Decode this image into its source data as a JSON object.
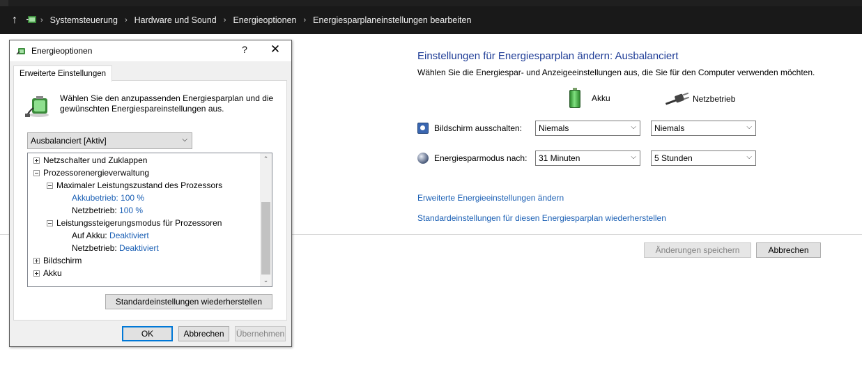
{
  "breadcrumb": [
    "Systemsteuerung",
    "Hardware und Sound",
    "Energieoptionen",
    "Energiesparplaneinstellungen bearbeiten"
  ],
  "panel": {
    "title": "Einstellungen für Energiesparplan ändern: Ausbalanciert",
    "subtitle": "Wählen Sie die Energiespar- und Anzeigeeinstellungen aus, die Sie für den Computer verwenden möchten.",
    "col_battery": "Akku",
    "col_power": "Netzbetrieb",
    "rows": [
      {
        "label": "Bildschirm ausschalten:",
        "battery": "Niemals",
        "power": "Niemals"
      },
      {
        "label": "Energiesparmodus nach:",
        "battery": "31 Minuten",
        "power": "5 Stunden"
      }
    ],
    "link_advanced": "Erweiterte Energieeinstellungen ändern",
    "link_restore": "Standardeinstellungen für diesen Energiesparplan wiederherstellen",
    "save_button": "Änderungen speichern",
    "cancel_button": "Abbrechen"
  },
  "dialog": {
    "title": "Energieoptionen",
    "help": "?",
    "close": "✕",
    "tab": "Erweiterte Einstellungen",
    "intro": "Wählen Sie den anzupassenden Energiesparplan und die gewünschten Energiespareinstellungen aus.",
    "plan": "Ausbalanciert [Aktiv]",
    "tree": {
      "netzschalter": "Netzschalter und Zuklappen",
      "prozessor": "Prozessorenergieverwaltung",
      "max_state": "Maximaler Leistungszustand des Prozessors",
      "max_battery_label": "Akkubetrieb:",
      "max_battery_value": "100 %",
      "max_power_label": "Netzbetrieb:",
      "max_power_value": "100 %",
      "boost": "Leistungssteigerungsmodus für Prozessoren",
      "boost_battery_label": "Auf Akku:",
      "boost_battery_value": "Deaktiviert",
      "boost_power_label": "Netzbetrieb:",
      "boost_power_value": "Deaktiviert",
      "bildschirm": "Bildschirm",
      "akku": "Akku"
    },
    "restore_button": "Standardeinstellungen wiederherstellen",
    "ok_button": "OK",
    "cancel_button": "Abbrechen",
    "apply_button": "Übernehmen"
  }
}
